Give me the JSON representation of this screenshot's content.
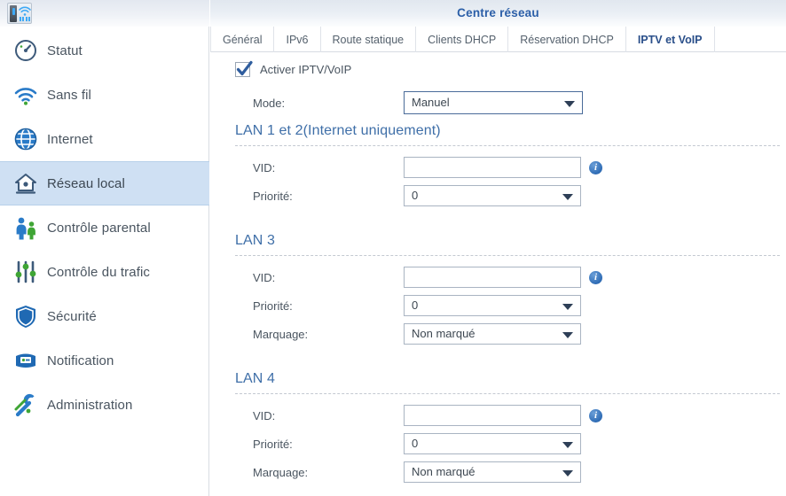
{
  "app": {
    "brand_icon": "router-device-icon",
    "title": "Centre réseau"
  },
  "sidebar": {
    "items": [
      {
        "label": "Statut",
        "icon": "speedometer-icon",
        "active": false
      },
      {
        "label": "Sans fil",
        "icon": "wifi-icon",
        "active": false
      },
      {
        "label": "Internet",
        "icon": "globe-icon",
        "active": false
      },
      {
        "label": "Réseau local",
        "icon": "home-network-icon",
        "active": true
      },
      {
        "label": "Contrôle parental",
        "icon": "parents-icon",
        "active": false
      },
      {
        "label": "Contrôle du trafic",
        "icon": "sliders-icon",
        "active": false
      },
      {
        "label": "Sécurité",
        "icon": "shield-icon",
        "active": false
      },
      {
        "label": "Notification",
        "icon": "envelope-icon",
        "active": false
      },
      {
        "label": "Administration",
        "icon": "wrench-icon",
        "active": false
      }
    ]
  },
  "tabs": [
    {
      "label": "Général",
      "active": false
    },
    {
      "label": "IPv6",
      "active": false
    },
    {
      "label": "Route statique",
      "active": false
    },
    {
      "label": "Clients DHCP",
      "active": false
    },
    {
      "label": "Réservation DHCP",
      "active": false
    },
    {
      "label": "IPTV et VoIP",
      "active": true
    }
  ],
  "form": {
    "enable_checkbox": {
      "label": "Activer IPTV/VoIP",
      "checked": true
    },
    "mode": {
      "label": "Mode:",
      "value": "Manuel"
    },
    "sections": [
      {
        "heading": "LAN 1 et 2(Internet uniquement)",
        "fields": [
          {
            "kind": "text",
            "label": "VID:",
            "value": "",
            "info": true
          },
          {
            "kind": "select",
            "label": "Priorité:",
            "value": "0",
            "info": false
          }
        ]
      },
      {
        "heading": "LAN 3",
        "fields": [
          {
            "kind": "text",
            "label": "VID:",
            "value": "",
            "info": true
          },
          {
            "kind": "select",
            "label": "Priorité:",
            "value": "0",
            "info": false
          },
          {
            "kind": "select",
            "label": "Marquage:",
            "value": "Non marqué",
            "info": false
          }
        ]
      },
      {
        "heading": "LAN 4",
        "fields": [
          {
            "kind": "text",
            "label": "VID:",
            "value": "",
            "info": true
          },
          {
            "kind": "select",
            "label": "Priorité:",
            "value": "0",
            "info": false
          },
          {
            "kind": "select",
            "label": "Marquage:",
            "value": "Non marqué",
            "info": false
          }
        ]
      }
    ]
  },
  "colors": {
    "title_blue": "#2c5fa8",
    "section_blue": "#3f6fa8",
    "active_tab_blue": "#2a4f8a",
    "sidebar_active_bg": "#cfe0f3",
    "info_icon_blue": "#2f6cb5",
    "text_gray": "#4a5560"
  }
}
